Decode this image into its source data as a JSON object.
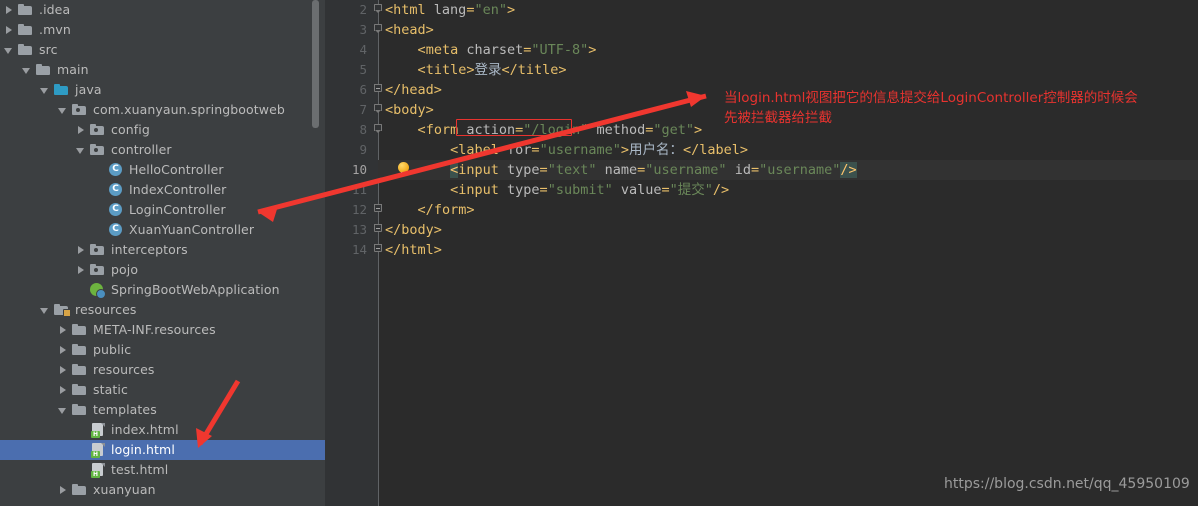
{
  "project_panel": {
    "tree": [
      {
        "indent": 0,
        "twisty": "collapsed",
        "icon": "folder",
        "label": ".idea"
      },
      {
        "indent": 0,
        "twisty": "collapsed",
        "icon": "folder",
        "label": ".mvn"
      },
      {
        "indent": 0,
        "twisty": "expanded",
        "icon": "folder",
        "label": "src"
      },
      {
        "indent": 1,
        "twisty": "expanded",
        "icon": "folder",
        "label": "main"
      },
      {
        "indent": 2,
        "twisty": "expanded",
        "icon": "folder-src",
        "label": "java"
      },
      {
        "indent": 3,
        "twisty": "expanded",
        "icon": "folder-pkg",
        "label": "com.xuanyaun.springbootweb"
      },
      {
        "indent": 4,
        "twisty": "collapsed",
        "icon": "folder-pkg",
        "label": "config"
      },
      {
        "indent": 4,
        "twisty": "expanded",
        "icon": "folder-pkg",
        "label": "controller"
      },
      {
        "indent": 5,
        "twisty": "none",
        "icon": "class",
        "label": "HelloController"
      },
      {
        "indent": 5,
        "twisty": "none",
        "icon": "class",
        "label": "IndexController"
      },
      {
        "indent": 5,
        "twisty": "none",
        "icon": "class",
        "label": "LoginController"
      },
      {
        "indent": 5,
        "twisty": "none",
        "icon": "class",
        "label": "XuanYuanController"
      },
      {
        "indent": 4,
        "twisty": "collapsed",
        "icon": "folder-pkg",
        "label": "interceptors"
      },
      {
        "indent": 4,
        "twisty": "collapsed",
        "icon": "folder-pkg",
        "label": "pojo"
      },
      {
        "indent": 4,
        "twisty": "none",
        "icon": "spring",
        "label": "SpringBootWebApplication"
      },
      {
        "indent": 2,
        "twisty": "expanded",
        "icon": "folder-res",
        "label": "resources"
      },
      {
        "indent": 3,
        "twisty": "collapsed",
        "icon": "folder",
        "label": "META-INF.resources"
      },
      {
        "indent": 3,
        "twisty": "collapsed",
        "icon": "folder",
        "label": "public"
      },
      {
        "indent": 3,
        "twisty": "collapsed",
        "icon": "folder",
        "label": "resources"
      },
      {
        "indent": 3,
        "twisty": "collapsed",
        "icon": "folder",
        "label": "static"
      },
      {
        "indent": 3,
        "twisty": "expanded",
        "icon": "folder",
        "label": "templates"
      },
      {
        "indent": 4,
        "twisty": "none",
        "icon": "html",
        "label": "index.html"
      },
      {
        "indent": 4,
        "twisty": "none",
        "icon": "html",
        "label": "login.html",
        "selected": true
      },
      {
        "indent": 4,
        "twisty": "none",
        "icon": "html",
        "label": "test.html"
      },
      {
        "indent": 3,
        "twisty": "collapsed",
        "icon": "folder",
        "label": "xuanyuan"
      }
    ]
  },
  "editor": {
    "lines": [
      {
        "num": "2",
        "fold": "start",
        "indent": 0,
        "parts": [
          {
            "t": "<",
            "c": "brk"
          },
          {
            "t": "html",
            "c": "tag"
          },
          {
            "t": " ",
            "c": "txt"
          },
          {
            "t": "lang",
            "c": "attr"
          },
          {
            "t": "=",
            "c": "brk"
          },
          {
            "t": "\"en\"",
            "c": "str"
          },
          {
            "t": ">",
            "c": "brk"
          }
        ]
      },
      {
        "num": "3",
        "fold": "start",
        "indent": 0,
        "parts": [
          {
            "t": "<",
            "c": "brk"
          },
          {
            "t": "head",
            "c": "tag"
          },
          {
            "t": ">",
            "c": "brk"
          }
        ]
      },
      {
        "num": "4",
        "fold": "none",
        "indent": 4,
        "parts": [
          {
            "t": "<",
            "c": "brk"
          },
          {
            "t": "meta",
            "c": "tag"
          },
          {
            "t": " ",
            "c": "txt"
          },
          {
            "t": "charset",
            "c": "attr"
          },
          {
            "t": "=",
            "c": "brk"
          },
          {
            "t": "\"UTF-8\"",
            "c": "str"
          },
          {
            "t": ">",
            "c": "brk"
          }
        ]
      },
      {
        "num": "5",
        "fold": "none",
        "indent": 4,
        "parts": [
          {
            "t": "<",
            "c": "brk"
          },
          {
            "t": "title",
            "c": "tag"
          },
          {
            "t": ">",
            "c": "brk"
          },
          {
            "t": "登录",
            "c": "txt"
          },
          {
            "t": "</",
            "c": "brk"
          },
          {
            "t": "title",
            "c": "tag"
          },
          {
            "t": ">",
            "c": "brk"
          }
        ]
      },
      {
        "num": "6",
        "fold": "end",
        "indent": 0,
        "parts": [
          {
            "t": "</",
            "c": "brk"
          },
          {
            "t": "head",
            "c": "tag"
          },
          {
            "t": ">",
            "c": "brk"
          }
        ]
      },
      {
        "num": "7",
        "fold": "start",
        "indent": 0,
        "parts": [
          {
            "t": "<",
            "c": "brk"
          },
          {
            "t": "body",
            "c": "tag"
          },
          {
            "t": ">",
            "c": "brk"
          }
        ]
      },
      {
        "num": "8",
        "fold": "start",
        "indent": 4,
        "parts": [
          {
            "t": "<",
            "c": "brk"
          },
          {
            "t": "form",
            "c": "tag"
          },
          {
            "t": " ",
            "c": "txt"
          },
          {
            "t": "action",
            "c": "attr"
          },
          {
            "t": "=",
            "c": "brk"
          },
          {
            "t": "\"/login\"",
            "c": "str"
          },
          {
            "t": " ",
            "c": "txt"
          },
          {
            "t": "method",
            "c": "attr"
          },
          {
            "t": "=",
            "c": "brk"
          },
          {
            "t": "\"get\"",
            "c": "str"
          },
          {
            "t": ">",
            "c": "brk"
          }
        ]
      },
      {
        "num": "9",
        "fold": "none",
        "indent": 8,
        "parts": [
          {
            "t": "<",
            "c": "brk"
          },
          {
            "t": "label",
            "c": "tag"
          },
          {
            "t": " ",
            "c": "txt"
          },
          {
            "t": "for",
            "c": "attr"
          },
          {
            "t": "=",
            "c": "brk"
          },
          {
            "t": "\"username\"",
            "c": "str"
          },
          {
            "t": ">",
            "c": "brk"
          },
          {
            "t": "用户名：",
            "c": "txt"
          },
          {
            "t": "</",
            "c": "brk"
          },
          {
            "t": "label",
            "c": "tag"
          },
          {
            "t": ">",
            "c": "brk"
          }
        ]
      },
      {
        "num": "10",
        "fold": "none",
        "indent": 8,
        "current": true,
        "bulb": true,
        "parts": [
          {
            "t": "<",
            "c": "hl-brace"
          },
          {
            "t": "input",
            "c": "tag"
          },
          {
            "t": " ",
            "c": "txt"
          },
          {
            "t": "type",
            "c": "attr"
          },
          {
            "t": "=",
            "c": "brk"
          },
          {
            "t": "\"text\"",
            "c": "str"
          },
          {
            "t": " ",
            "c": "txt"
          },
          {
            "t": "name",
            "c": "attr"
          },
          {
            "t": "=",
            "c": "brk"
          },
          {
            "t": "\"username\"",
            "c": "str"
          },
          {
            "t": " ",
            "c": "txt"
          },
          {
            "t": "id",
            "c": "attr"
          },
          {
            "t": "=",
            "c": "brk"
          },
          {
            "t": "\"username\"",
            "c": "str"
          },
          {
            "t": "/>",
            "c": "hl-brace"
          }
        ]
      },
      {
        "num": "11",
        "fold": "none",
        "indent": 8,
        "parts": [
          {
            "t": "<",
            "c": "brk"
          },
          {
            "t": "input",
            "c": "tag"
          },
          {
            "t": " ",
            "c": "txt"
          },
          {
            "t": "type",
            "c": "attr"
          },
          {
            "t": "=",
            "c": "brk"
          },
          {
            "t": "\"submit\"",
            "c": "str"
          },
          {
            "t": " ",
            "c": "txt"
          },
          {
            "t": "value",
            "c": "attr"
          },
          {
            "t": "=",
            "c": "brk"
          },
          {
            "t": "\"提交\"",
            "c": "str"
          },
          {
            "t": "/>",
            "c": "brk"
          }
        ]
      },
      {
        "num": "12",
        "fold": "end",
        "indent": 4,
        "parts": [
          {
            "t": "</",
            "c": "brk"
          },
          {
            "t": "form",
            "c": "tag"
          },
          {
            "t": ">",
            "c": "brk"
          }
        ]
      },
      {
        "num": "13",
        "fold": "end",
        "indent": 0,
        "parts": [
          {
            "t": "</",
            "c": "brk"
          },
          {
            "t": "body",
            "c": "tag"
          },
          {
            "t": ">",
            "c": "brk"
          }
        ]
      },
      {
        "num": "14",
        "fold": "end",
        "indent": 0,
        "parts": [
          {
            "t": "</",
            "c": "brk"
          },
          {
            "t": "html",
            "c": "tag"
          },
          {
            "t": ">",
            "c": "brk"
          }
        ]
      }
    ]
  },
  "annotation": {
    "line1": "当login.html视图把它的信息提交给LoginController控制器的时候会",
    "line2": "先被拦截器给拦截",
    "color": "#e8332f"
  },
  "watermark": {
    "text": "https://blog.csdn.net/qq_45950109"
  },
  "colors": {
    "panel_bg": "#3c3f41",
    "editor_bg": "#2b2b2b",
    "gutter_bg": "#313335",
    "selection": "#4b6eaf",
    "annotation_red": "#e8332f",
    "string_green": "#6a8759",
    "tag_gold": "#e8bf6a",
    "attr_grey": "#bababa"
  }
}
